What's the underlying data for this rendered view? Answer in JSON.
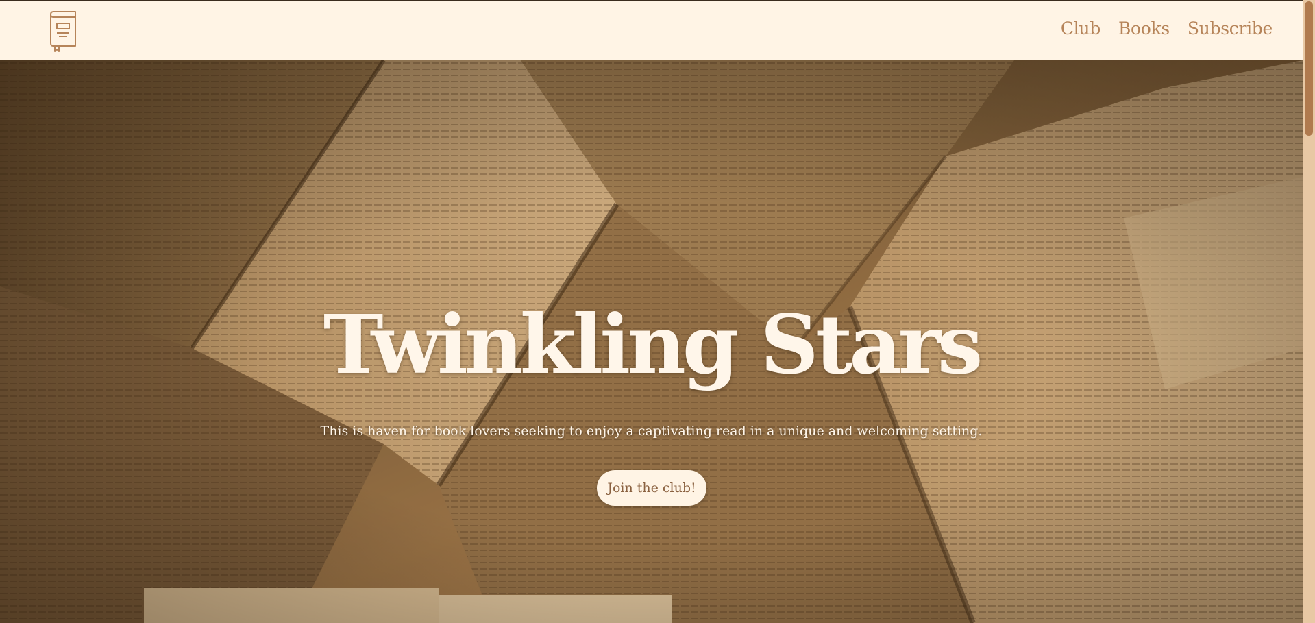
{
  "header": {
    "logo_icon": "book-icon",
    "nav": [
      {
        "label": "Club"
      },
      {
        "label": "Books"
      },
      {
        "label": "Subscribe"
      }
    ]
  },
  "hero": {
    "title": "Twinkling Stars",
    "subtitle": "This is haven for book lovers seeking to enjoy a captivating read in a unique and welcoming setting.",
    "cta_label": "Join the club!",
    "background_image": "open-books-photo"
  },
  "colors": {
    "header_bg": "#fff4e5",
    "accent": "#b68459",
    "hero_text": "#fff6ea",
    "button_text": "#8a6140",
    "scroll_track": "#e8c8a4",
    "scroll_thumb": "#b07a4e"
  }
}
